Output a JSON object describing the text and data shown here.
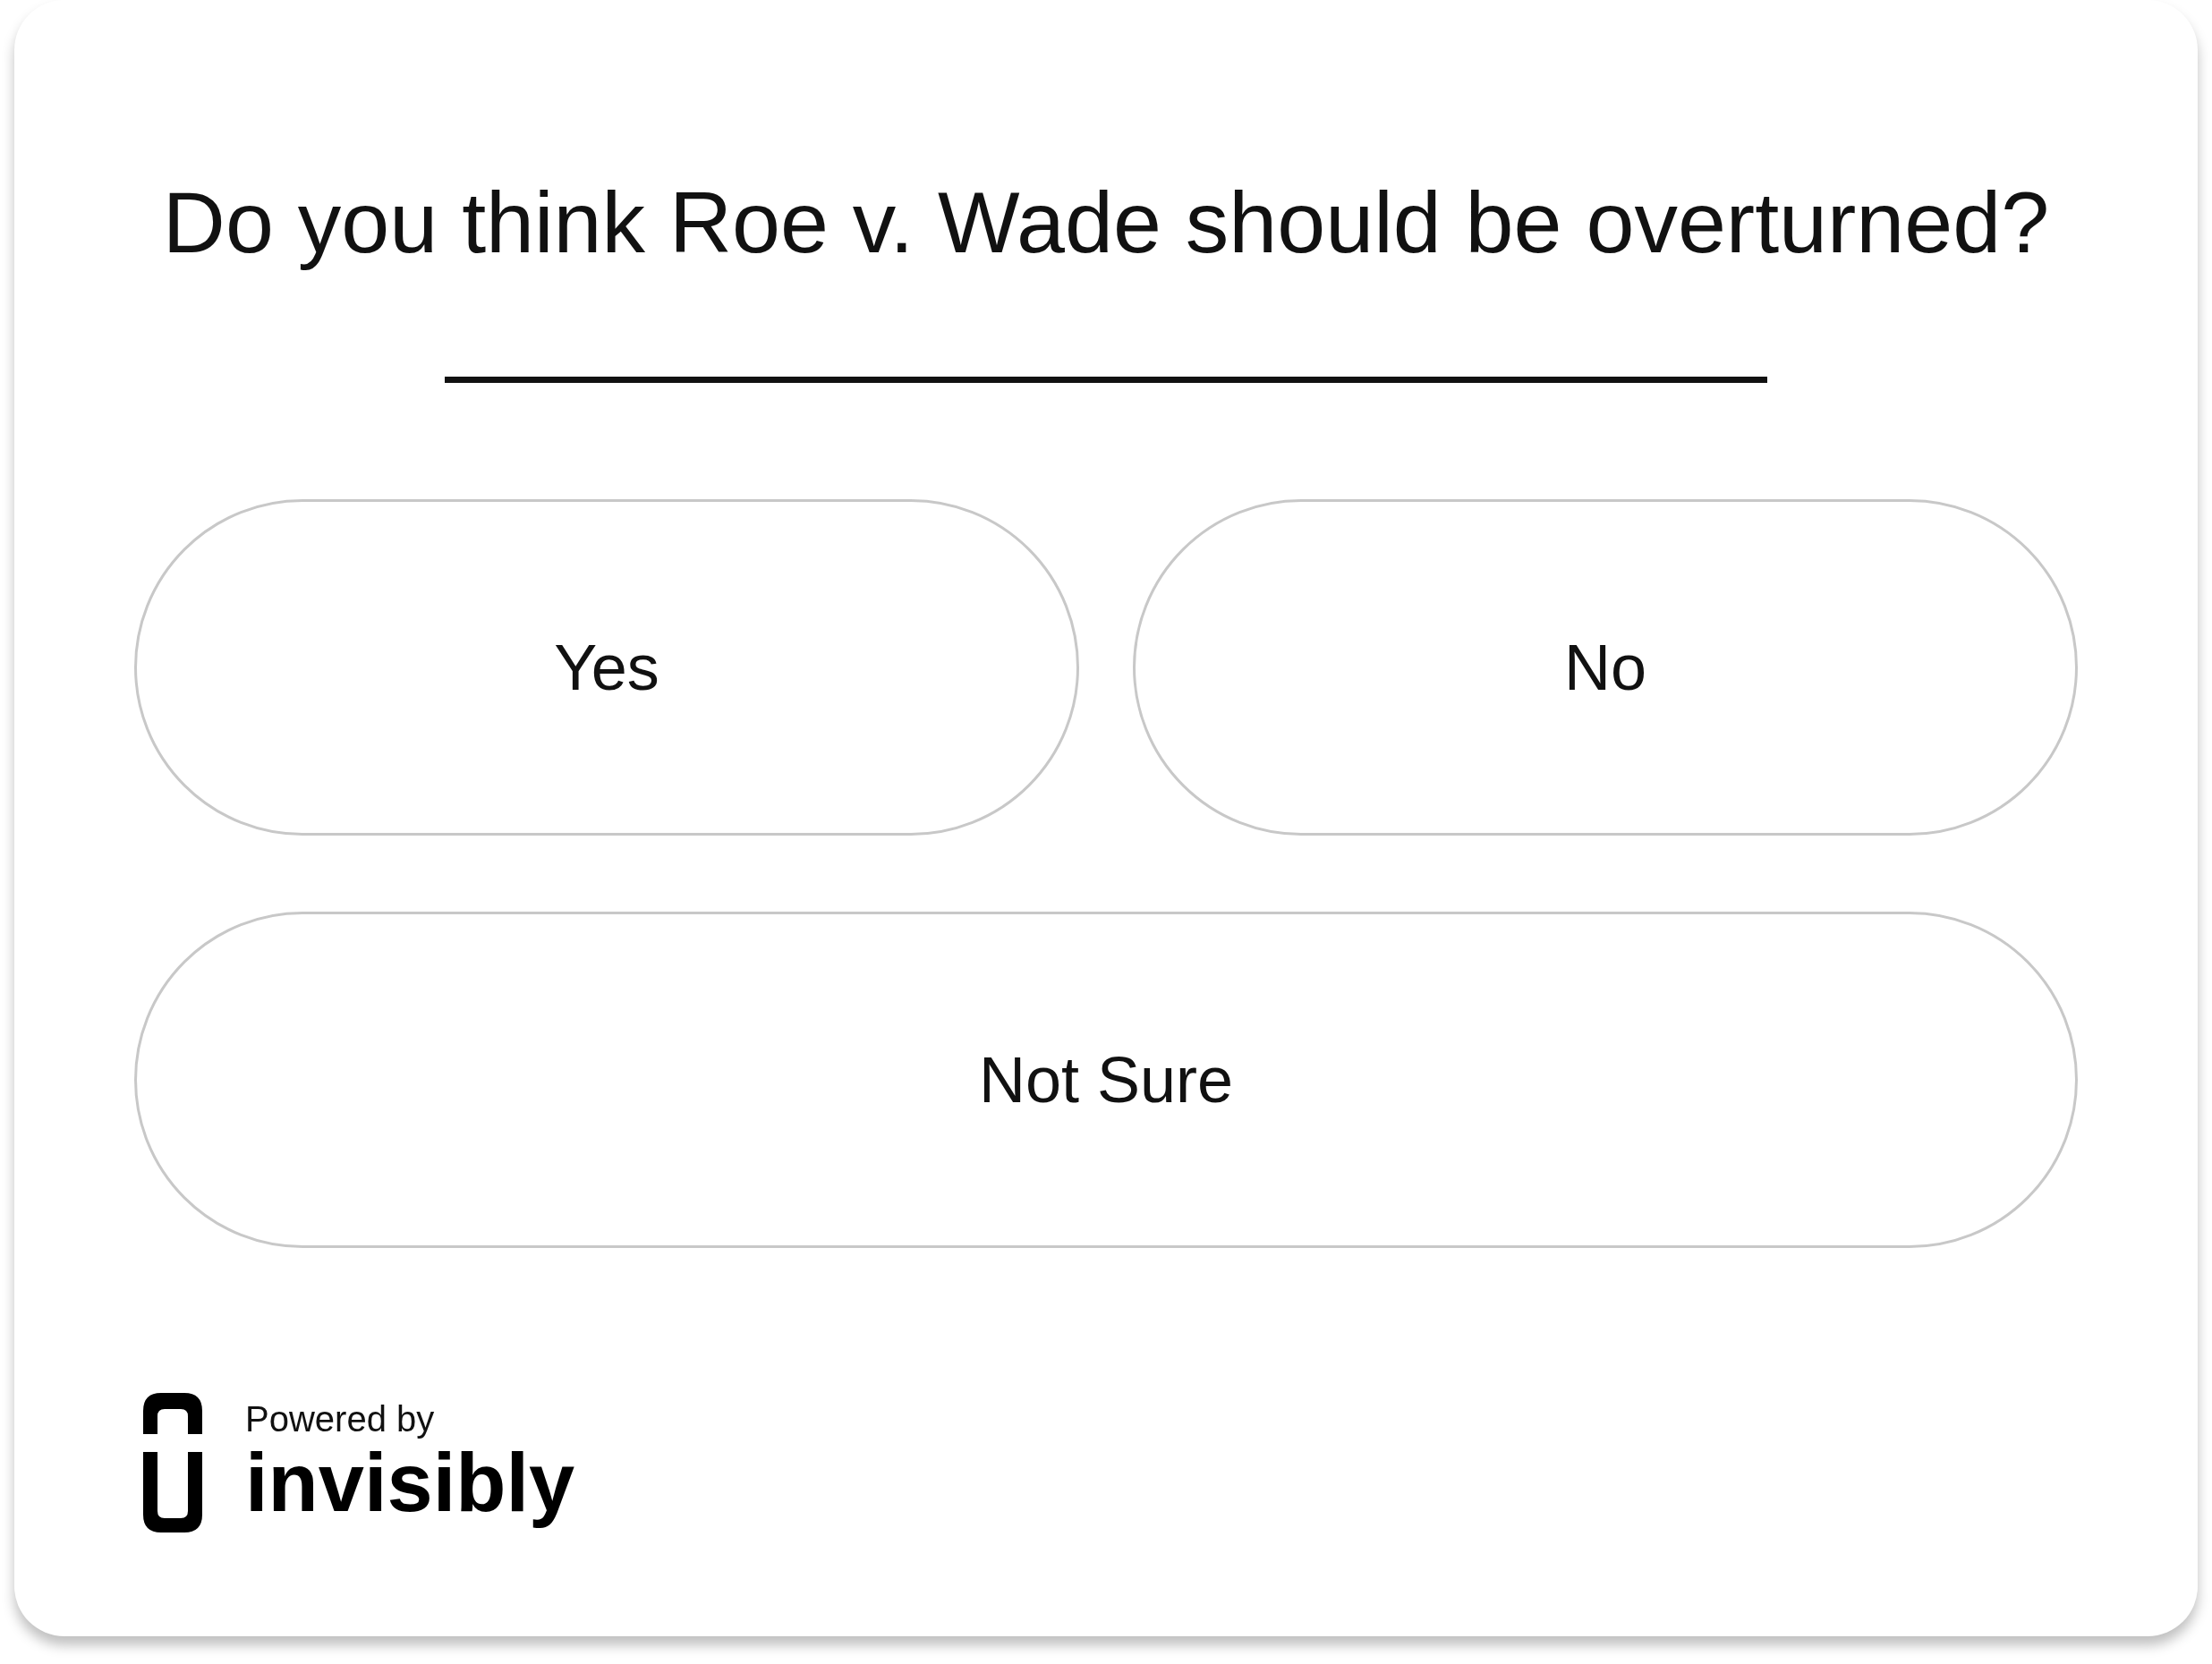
{
  "question": "Do you think Roe v. Wade should be overturned?",
  "answers": [
    {
      "label": "Yes",
      "wide": false
    },
    {
      "label": "No",
      "wide": false
    },
    {
      "label": "Not Sure",
      "wide": true
    }
  ],
  "footer": {
    "powered_by": "Powered by",
    "brand": "invisibly"
  }
}
